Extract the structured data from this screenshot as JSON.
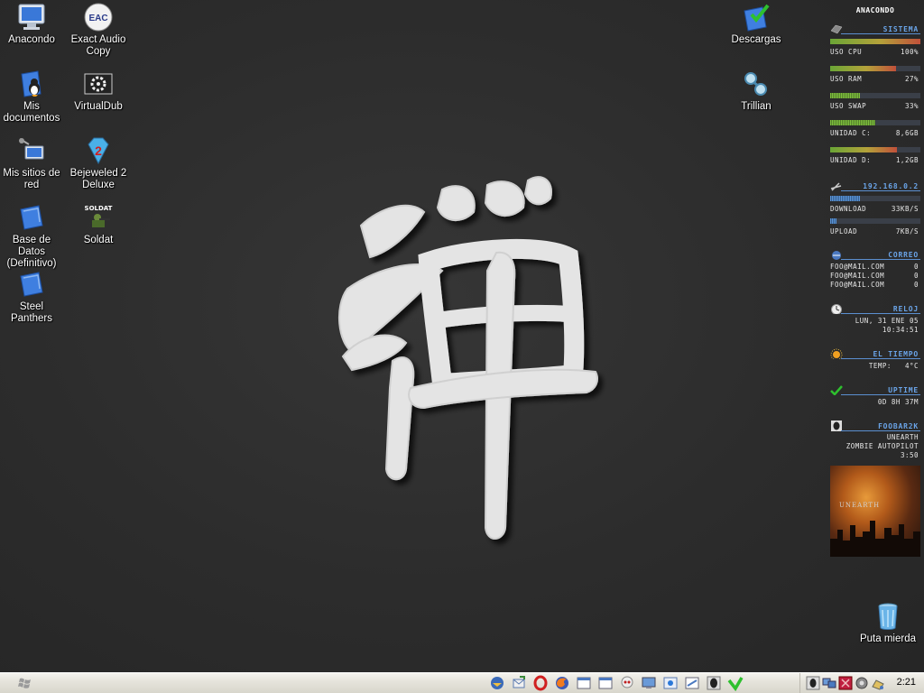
{
  "desktop": {
    "icons": [
      {
        "label": "Anacondo",
        "icon": "computer-icon"
      },
      {
        "label": "Exact Audio Copy",
        "icon": "eac-icon"
      },
      {
        "label": "Mis documentos",
        "icon": "documents-icon"
      },
      {
        "label": "VirtualDub",
        "icon": "virtualdub-icon"
      },
      {
        "label": "Mis sitios de red",
        "icon": "network-places-icon"
      },
      {
        "label": "Bejeweled 2 Deluxe",
        "icon": "bejeweled-icon"
      },
      {
        "label": "Base de Datos (Definitivo)",
        "icon": "folder-icon"
      },
      {
        "label": "Soldat",
        "icon": "soldat-icon"
      },
      {
        "label": "Steel Panthers",
        "icon": "folder-icon"
      },
      {
        "label": "Descargas",
        "icon": "downloads-icon"
      },
      {
        "label": "Trillian",
        "icon": "trillian-icon"
      },
      {
        "label": "Puta mierda",
        "icon": "recycle-bin-icon"
      }
    ],
    "eac_badge": "EAC",
    "soldat_badge": "SOLDAT"
  },
  "sidebar": {
    "title": "ANACONDO",
    "sistema": {
      "title": "SISTEMA",
      "rows": [
        {
          "key": "USO CPU",
          "value": "100%",
          "level": 1.0
        },
        {
          "key": "USO RAM",
          "value": "27%",
          "level": 0.73
        },
        {
          "key": "USO SWAP",
          "value": "33%",
          "level": 0.33
        },
        {
          "key": "UNIDAD C:",
          "value": "8,6GB",
          "level": 0.5
        },
        {
          "key": "UNIDAD D:",
          "value": "1,2GB",
          "level": 0.74
        }
      ]
    },
    "network": {
      "title": "192.168.0.2",
      "rows": [
        {
          "key": "DOWNLOAD",
          "value": "33KB/S",
          "level": 0.33
        },
        {
          "key": "UPLOAD",
          "value": "7KB/S",
          "level": 0.07
        }
      ]
    },
    "correo": {
      "title": "CORREO",
      "rows": [
        {
          "key": "FOO@MAIL.COM",
          "value": "0"
        },
        {
          "key": "FOO@MAIL.COM",
          "value": "0"
        },
        {
          "key": "FOO@MAIL.COM",
          "value": "0"
        }
      ]
    },
    "reloj": {
      "title": "RELOJ",
      "date": "LUN, 31 ENE 05",
      "time": "10:34:51"
    },
    "tiempo": {
      "title": "EL TIEMPO",
      "temp_label": "TEMP:",
      "temp_value": "4°C"
    },
    "uptime": {
      "title": "UPTIME",
      "value": "0D 8H 37M"
    },
    "foobar": {
      "title": "FOOBAR2K",
      "artist": "UNEARTH",
      "track": "ZOMBIE AUTOPILOT",
      "time": "3:50",
      "album_text": "UNEARTH"
    }
  },
  "taskbar": {
    "clock": "2:21",
    "quicklaunch": [
      "thunderbird-icon",
      "outlook-icon",
      "opera-icon",
      "firefox-icon",
      "window-icon",
      "window-icon",
      "skull-icon",
      "monitor-icon",
      "explorer-icon",
      "window-icon",
      "alien-icon",
      "check-icon"
    ],
    "tray": [
      "alien-tray-icon",
      "network-tray-icon",
      "media-tray-icon",
      "speaker-tray-icon",
      "printer-tray-icon"
    ]
  },
  "colors": {
    "sidebar_accent": "#6aa4e8",
    "bar_green": "#7fbf3f",
    "bar_blue": "#5b93d6"
  }
}
